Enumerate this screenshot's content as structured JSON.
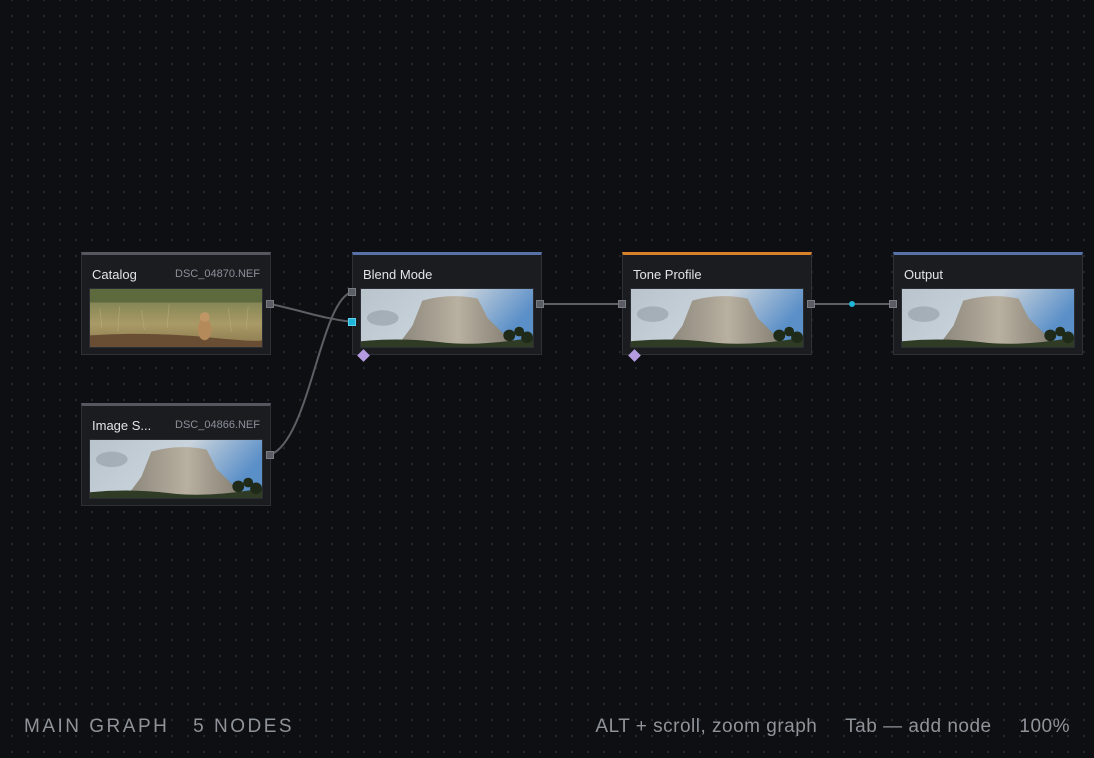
{
  "graph": {
    "name_label": "MAIN GRAPH",
    "node_count_label": "5 NODES"
  },
  "nodes": {
    "catalog": {
      "title": "Catalog",
      "file": "DSC_04870.NEF",
      "accent": "#55585e",
      "preview": "prairie-dog-photo"
    },
    "image_source": {
      "title": "Image S...",
      "file": "DSC_04866.NEF",
      "accent": "#55585e",
      "preview": "devils-tower-photo"
    },
    "blend_mode": {
      "title": "Blend Mode",
      "accent": "#5672a8",
      "preview": "devils-tower-photo"
    },
    "tone_profile": {
      "title": "Tone Profile",
      "accent": "#d9802c",
      "preview": "devils-tower-photo"
    },
    "output": {
      "title": "Output",
      "accent": "#5672a8",
      "preview": "devils-tower-photo"
    }
  },
  "hints": {
    "zoom_hint": "ALT + scroll, zoom graph",
    "add_node_hint": "Tab — add node",
    "zoom_level": "100%"
  },
  "colors": {
    "background": "#0e0f12",
    "node_bg": "#1a1c20",
    "wire": "#5c5f65",
    "port_active": "#1fb5d8",
    "mask_port": "#b59be0"
  }
}
